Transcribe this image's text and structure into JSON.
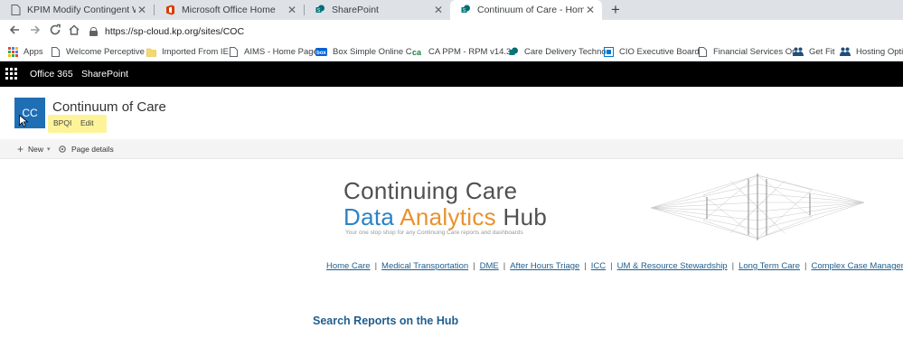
{
  "browser": {
    "tabs": [
      {
        "title": "KPIM Modify Contingent Worker",
        "favicon": "document-icon",
        "active": false
      },
      {
        "title": "Microsoft Office Home",
        "favicon": "office-icon",
        "active": false
      },
      {
        "title": "SharePoint",
        "favicon": "sharepoint-icon",
        "active": false
      },
      {
        "title": "Continuum of Care - Home",
        "favicon": "sharepoint-icon",
        "active": true
      }
    ],
    "new_tab_symbol": "+",
    "url": "https://sp-cloud.kp.org/sites/COC",
    "bookmarks": [
      {
        "label": "Apps",
        "icon": "apps-grid-icon"
      },
      {
        "label": "Welcome Perceptive",
        "icon": "document-icon"
      },
      {
        "label": "Imported From IE",
        "icon": "folder-icon"
      },
      {
        "label": "AIMS - Home Page",
        "icon": "document-icon"
      },
      {
        "label": "Box Simple Online C",
        "icon": "box-icon"
      },
      {
        "label": "CA PPM - RPM v14.3",
        "icon": "ca-icon"
      },
      {
        "label": "Care Delivery Techno",
        "icon": "sharepoint-icon"
      },
      {
        "label": "CIO Executive Board",
        "icon": "board-icon"
      },
      {
        "label": "Financial Services Or",
        "icon": "document-icon"
      },
      {
        "label": "Get Fit",
        "icon": "people-icon"
      },
      {
        "label": "Hosting Optio",
        "icon": "people-icon"
      }
    ]
  },
  "suite_bar": {
    "app_name": "Office 365",
    "product": "SharePoint"
  },
  "site": {
    "logo_initials": "CC",
    "title": "Continuum of Care",
    "nav": [
      "BPQI",
      "Edit"
    ]
  },
  "command_bar": {
    "new_label": "New",
    "page_details_label": "Page details"
  },
  "hub": {
    "title_line1": "Continuing Care",
    "title_line2_a": "Data",
    "title_line2_b": "Analytics",
    "title_line2_c": "Hub",
    "tagline": "Your one stop shop for any Continuing Care reports and dashboards",
    "links": [
      "Home Care",
      "Medical Transportation",
      "DME",
      "After Hours Triage",
      "ICC",
      "UM & Resource Stewardship",
      "Long Term Care",
      "Complex Case Management"
    ],
    "search_heading": "Search Reports on the Hub"
  },
  "colors": {
    "suite_bar_bg": "#000000",
    "logo_bg": "#1f6fb5",
    "highlight": "#fdf49a",
    "data_blue": "#2b83c7",
    "analytics_orange": "#e8922f",
    "link_blue": "#1f5e8e"
  }
}
